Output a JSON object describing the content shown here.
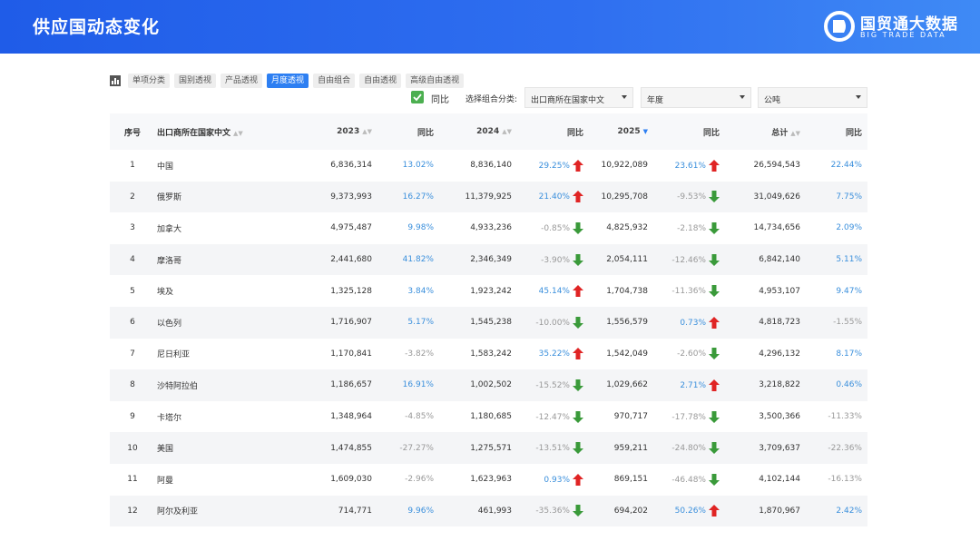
{
  "header": {
    "title": "供应国动态变化",
    "logo_cn": "国贸通大数据",
    "logo_en": "BIG TRADE DATA"
  },
  "tabs": [
    {
      "label": "单项分类",
      "active": false
    },
    {
      "label": "国别透视",
      "active": false
    },
    {
      "label": "产品透视",
      "active": false
    },
    {
      "label": "月度透视",
      "active": true
    },
    {
      "label": "自由组合",
      "active": false
    },
    {
      "label": "自由透视",
      "active": false
    },
    {
      "label": "高级自由透视",
      "active": false
    }
  ],
  "filters": {
    "yoy_checkbox_label": "同比",
    "yoy_checked": true,
    "combo_label": "选择组合分类:",
    "combo_value": "出口商所在国家中文",
    "period_value": "年度",
    "unit_value": "公吨"
  },
  "columns": {
    "idx": "序号",
    "name": "出口商所在国家中文",
    "y2023": "2023",
    "yoy1": "同比",
    "y2024": "2024",
    "yoy2": "同比",
    "y2025": "2025",
    "yoy3": "同比",
    "total": "总计",
    "yoy4": "同比"
  },
  "rows": [
    {
      "idx": "1",
      "name": "中国",
      "v2023": "6,836,314",
      "p2023": "13.02%",
      "v2024": "8,836,140",
      "p2024": "29.25%",
      "v2025": "10,922,089",
      "p2025": "23.61%",
      "total": "26,594,543",
      "ptotal": "22.44%"
    },
    {
      "idx": "2",
      "name": "俄罗斯",
      "v2023": "9,373,993",
      "p2023": "16.27%",
      "v2024": "11,379,925",
      "p2024": "21.40%",
      "v2025": "10,295,708",
      "p2025": "-9.53%",
      "total": "31,049,626",
      "ptotal": "7.75%"
    },
    {
      "idx": "3",
      "name": "加拿大",
      "v2023": "4,975,487",
      "p2023": "9.98%",
      "v2024": "4,933,236",
      "p2024": "-0.85%",
      "v2025": "4,825,932",
      "p2025": "-2.18%",
      "total": "14,734,656",
      "ptotal": "2.09%"
    },
    {
      "idx": "4",
      "name": "摩洛哥",
      "v2023": "2,441,680",
      "p2023": "41.82%",
      "v2024": "2,346,349",
      "p2024": "-3.90%",
      "v2025": "2,054,111",
      "p2025": "-12.46%",
      "total": "6,842,140",
      "ptotal": "5.11%"
    },
    {
      "idx": "5",
      "name": "埃及",
      "v2023": "1,325,128",
      "p2023": "3.84%",
      "v2024": "1,923,242",
      "p2024": "45.14%",
      "v2025": "1,704,738",
      "p2025": "-11.36%",
      "total": "4,953,107",
      "ptotal": "9.47%"
    },
    {
      "idx": "6",
      "name": "以色列",
      "v2023": "1,716,907",
      "p2023": "5.17%",
      "v2024": "1,545,238",
      "p2024": "-10.00%",
      "v2025": "1,556,579",
      "p2025": "0.73%",
      "total": "4,818,723",
      "ptotal": "-1.55%"
    },
    {
      "idx": "7",
      "name": "尼日利亚",
      "v2023": "1,170,841",
      "p2023": "-3.82%",
      "v2024": "1,583,242",
      "p2024": "35.22%",
      "v2025": "1,542,049",
      "p2025": "-2.60%",
      "total": "4,296,132",
      "ptotal": "8.17%"
    },
    {
      "idx": "8",
      "name": "沙特阿拉伯",
      "v2023": "1,186,657",
      "p2023": "16.91%",
      "v2024": "1,002,502",
      "p2024": "-15.52%",
      "v2025": "1,029,662",
      "p2025": "2.71%",
      "total": "3,218,822",
      "ptotal": "0.46%"
    },
    {
      "idx": "9",
      "name": "卡塔尔",
      "v2023": "1,348,964",
      "p2023": "-4.85%",
      "v2024": "1,180,685",
      "p2024": "-12.47%",
      "v2025": "970,717",
      "p2025": "-17.78%",
      "total": "3,500,366",
      "ptotal": "-11.33%"
    },
    {
      "idx": "10",
      "name": "美国",
      "v2023": "1,474,855",
      "p2023": "-27.27%",
      "v2024": "1,275,571",
      "p2024": "-13.51%",
      "v2025": "959,211",
      "p2025": "-24.80%",
      "total": "3,709,637",
      "ptotal": "-22.36%"
    },
    {
      "idx": "11",
      "name": "阿曼",
      "v2023": "1,609,030",
      "p2023": "-2.96%",
      "v2024": "1,623,963",
      "p2024": "0.93%",
      "v2025": "869,151",
      "p2025": "-46.48%",
      "total": "4,102,144",
      "ptotal": "-16.13%"
    },
    {
      "idx": "12",
      "name": "阿尔及利亚",
      "v2023": "714,771",
      "p2023": "9.96%",
      "v2024": "461,993",
      "p2024": "-35.36%",
      "v2025": "694,202",
      "p2025": "50.26%",
      "total": "1,870,967",
      "ptotal": "2.42%"
    }
  ],
  "colors": {
    "header_blue": "#2f6ff0",
    "active_tab": "#2d7ff2",
    "positive": "#3a8fdc",
    "negative": "#999999",
    "arrow_up": "#e02424",
    "arrow_down": "#3a9a3a"
  },
  "icons": {
    "table_icon": "bar-chart-icon",
    "up_arrow": "arrow-up-icon",
    "down_arrow": "arrow-down-icon",
    "check": "check-icon",
    "sort": "sort-icon"
  }
}
